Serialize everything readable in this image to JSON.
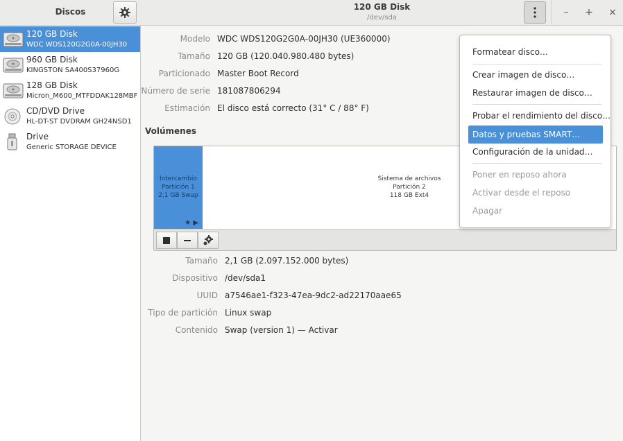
{
  "sidebar": {
    "title": "Discos",
    "items": [
      {
        "name": "120 GB Disk",
        "model": "WDC WDS120G2G0A-00JH30",
        "icon": "hdd-icon",
        "selected": true
      },
      {
        "name": "960 GB Disk",
        "model": "KINGSTON SA400S37960G",
        "icon": "hdd-icon",
        "selected": false
      },
      {
        "name": "128 GB Disk",
        "model": "Micron_M600_MTFDDAK128MBF",
        "icon": "hdd-icon",
        "selected": false
      },
      {
        "name": "CD/DVD Drive",
        "model": "HL-DT-ST DVDRAM GH24NSD1",
        "icon": "optical-disc-icon",
        "selected": false
      },
      {
        "name": "Drive",
        "model": "Generic STORAGE DEVICE",
        "icon": "usb-drive-icon",
        "selected": false
      }
    ]
  },
  "header": {
    "title": "120 GB Disk",
    "subtitle": "/dev/sda"
  },
  "disk_info": [
    {
      "label": "Modelo",
      "value": "WDC WDS120G2G0A-00JH30 (UE360000)"
    },
    {
      "label": "Tamaño",
      "value": "120 GB (120.040.980.480 bytes)"
    },
    {
      "label": "Particionado",
      "value": "Master Boot Record"
    },
    {
      "label": "Número de serie",
      "value": "181087806294"
    },
    {
      "label": "Estimación",
      "value": "El disco está correcto (31° C / 88° F)"
    }
  ],
  "volumes": {
    "title": "Volúmenes",
    "partitions": [
      {
        "line1": "Intercambio",
        "line2": "Partición 1",
        "line3": "2,1 GB Swap",
        "marks": "★ ▶"
      },
      {
        "line1": "Sistema de archivos",
        "line2": "Partición 2",
        "line3": "118 GB Ext4"
      }
    ]
  },
  "partition_info": [
    {
      "label": "Tamaño",
      "value": "2,1 GB (2.097.152.000 bytes)"
    },
    {
      "label": "Dispositivo",
      "value": "/dev/sda1"
    },
    {
      "label": "UUID",
      "value": "a7546ae1-f323-47ea-9dc2-ad22170aae65"
    },
    {
      "label": "Tipo de partición",
      "value": "Linux swap"
    },
    {
      "label": "Contenido",
      "value": "Swap (version 1) — Activar"
    }
  ],
  "menu": {
    "items": [
      {
        "label": "Formatear disco…",
        "state": "normal"
      },
      {
        "label": "Crear imagen de disco…",
        "state": "normal"
      },
      {
        "label": "Restaurar imagen de disco…",
        "state": "normal"
      },
      {
        "label": "Probar el rendimiento del disco…",
        "state": "normal"
      },
      {
        "label": "Datos y pruebas SMART…",
        "state": "active"
      },
      {
        "label": "Configuración de la unidad…",
        "state": "normal"
      },
      {
        "label": "Poner en reposo ahora",
        "state": "disabled"
      },
      {
        "label": "Activar desde el reposo",
        "state": "disabled"
      },
      {
        "label": "Apagar",
        "state": "disabled"
      }
    ]
  },
  "window_controls": {
    "minimize": "–",
    "maximize": "+",
    "close": "×"
  },
  "colors": {
    "accent": "#4a90d9",
    "label": "#8a8a8a"
  }
}
